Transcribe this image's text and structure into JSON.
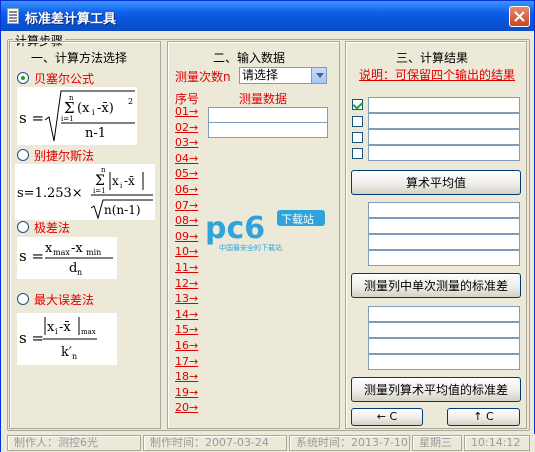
{
  "window": {
    "title": "标准差计算工具"
  },
  "group": {
    "label": "计算步骤"
  },
  "col1": {
    "heading": "一、计算方法选择",
    "methods": [
      {
        "label": "贝塞尔公式",
        "selected": true
      },
      {
        "label": "别捷尔斯法",
        "selected": false
      },
      {
        "label": "极差法",
        "selected": false
      },
      {
        "label": "最大误差法",
        "selected": false
      }
    ]
  },
  "col2": {
    "heading": "二、输入数据",
    "count_label": "测量次数n",
    "select_value": "请选择",
    "seq_header": "序号",
    "data_header": "测量数据",
    "rows": [
      "01→",
      "02→",
      "03→",
      "04→",
      "05→",
      "06→",
      "07→",
      "08→",
      "09→",
      "10→",
      "11→",
      "12→",
      "13→",
      "14→",
      "15→",
      "16→",
      "17→",
      "18→",
      "19→",
      "20→"
    ]
  },
  "col3": {
    "heading": "三、计算结果",
    "note": "说明：可保留四个输出的结果",
    "mean_button": "算术平均值",
    "single_std_button": "测量列中单次测量的标准差",
    "mean_std_button": "测量列算术平均值的标准差",
    "back_button": "← C",
    "up_button": "↑ C"
  },
  "watermark": {
    "brand": "pc6",
    "sub": "下载站",
    "tagline": "中国最安全的下载站"
  },
  "status": {
    "author": "制作人：测控6光",
    "date": "制作时间：2007-03-24",
    "systime": "系统时间：2013-7-10",
    "weekday": "星期三",
    "clock": "10:14:12"
  },
  "colors": {
    "title_bg": "#0a5fe6",
    "accent_red": "#e00000",
    "radio_green": "#21a121"
  }
}
